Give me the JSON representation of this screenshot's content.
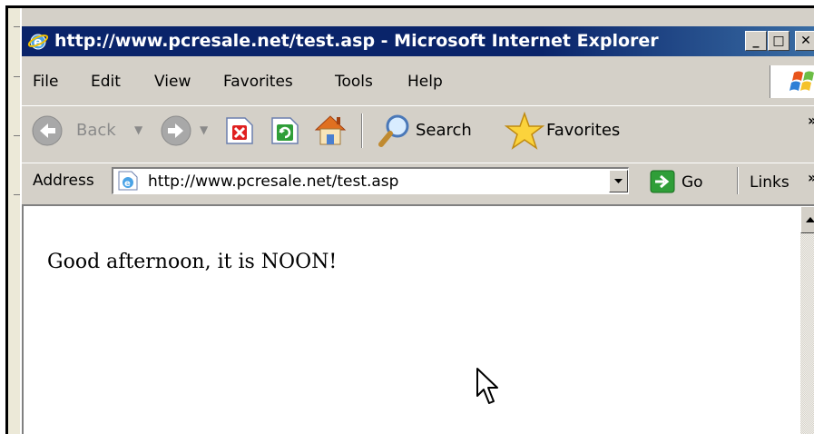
{
  "window": {
    "title": "http://www.pcresale.net/test.asp - Microsoft Internet Explorer",
    "controls": {
      "minimize": "_",
      "maximize": "□",
      "close": "✕"
    },
    "title_icon": "ie-icon"
  },
  "menubar": {
    "items": [
      "File",
      "Edit",
      "View",
      "Favorites",
      "Tools",
      "Help"
    ],
    "logo_icon": "windows-logo-icon"
  },
  "toolbar": {
    "back_label": "Back",
    "search_label": "Search",
    "favorites_label": "Favorites",
    "overflow": "»"
  },
  "addressbar": {
    "label": "Address",
    "url": "http://www.pcresale.net/test.asp",
    "go_label": "Go",
    "links_label": "Links",
    "overflow": "»"
  },
  "page": {
    "body_text": "Good afternoon, it is NOON!"
  },
  "colors": {
    "titlebar": "#0a246a",
    "chrome": "#d4d0c8"
  }
}
